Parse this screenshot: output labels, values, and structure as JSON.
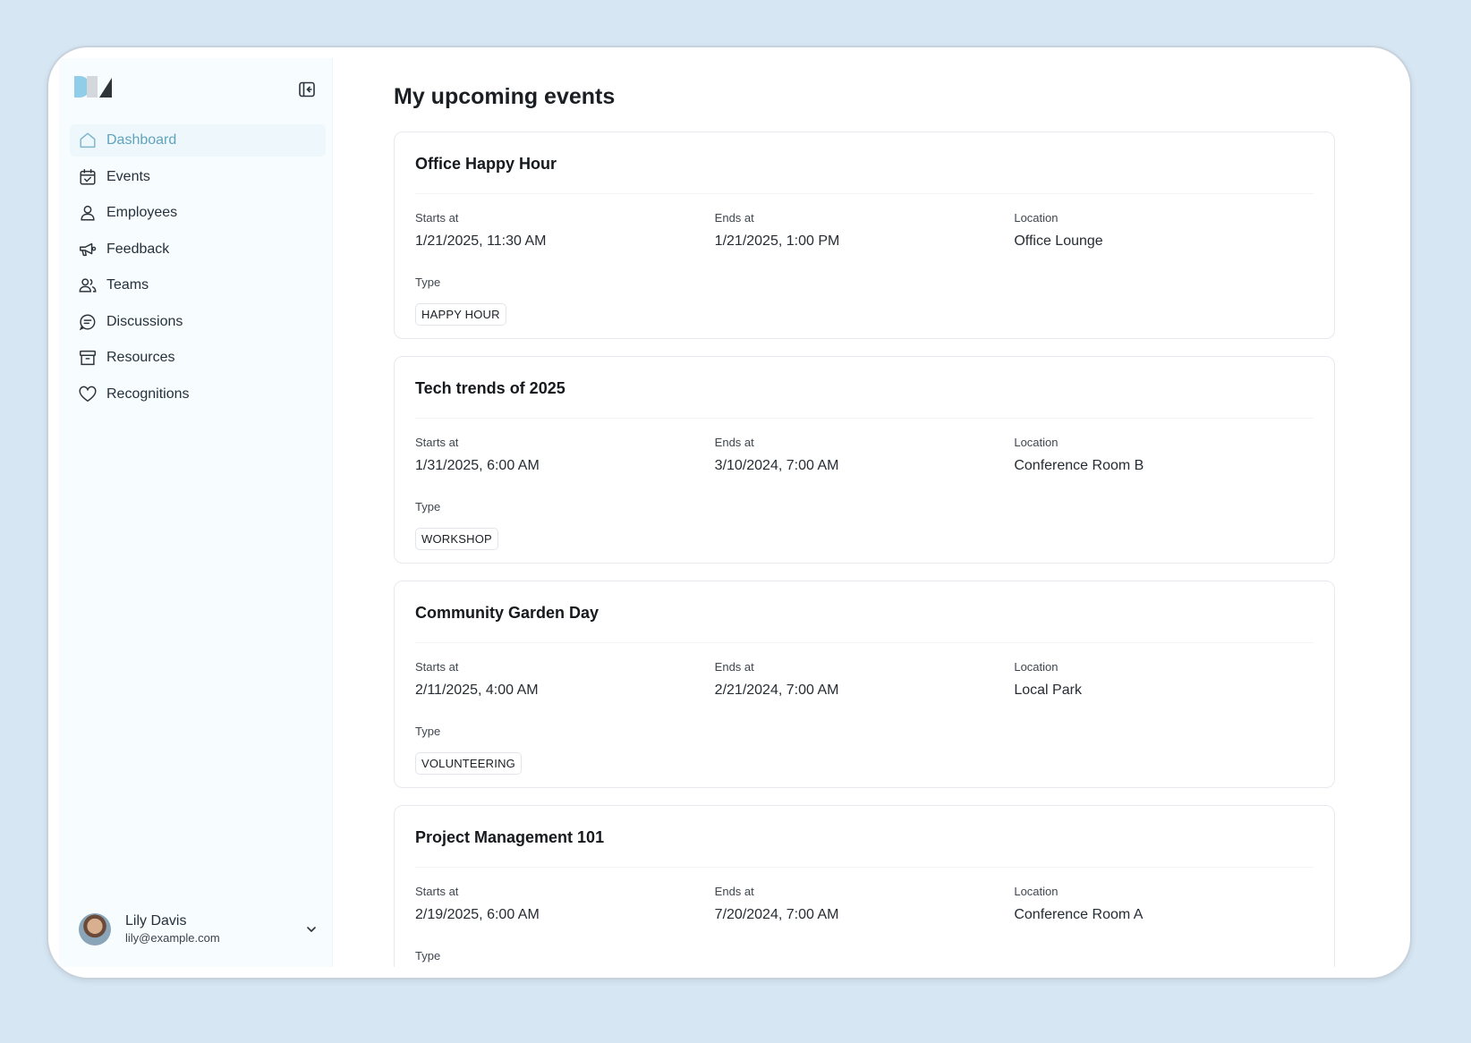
{
  "sidebar": {
    "logo": "brand-logo",
    "collapse_icon": "sidebar-collapse-icon",
    "items": [
      {
        "label": "Dashboard",
        "icon": "home-icon",
        "active": true
      },
      {
        "label": "Events",
        "icon": "calendar-check-icon",
        "active": false
      },
      {
        "label": "Employees",
        "icon": "user-icon",
        "active": false
      },
      {
        "label": "Feedback",
        "icon": "megaphone-icon",
        "active": false
      },
      {
        "label": "Teams",
        "icon": "users-icon",
        "active": false
      },
      {
        "label": "Discussions",
        "icon": "chat-bubble-icon",
        "active": false
      },
      {
        "label": "Resources",
        "icon": "archive-box-icon",
        "active": false
      },
      {
        "label": "Recognitions",
        "icon": "heart-icon",
        "active": false
      }
    ],
    "user": {
      "name": "Lily Davis",
      "email": "lily@example.com"
    }
  },
  "main": {
    "title": "My upcoming events",
    "field_labels": {
      "starts": "Starts at",
      "ends": "Ends at",
      "location": "Location",
      "type": "Type"
    },
    "events": [
      {
        "title": "Office Happy Hour",
        "starts": "1/21/2025, 11:30 AM",
        "ends": "1/21/2025, 1:00 PM",
        "location": "Office Lounge",
        "type": "HAPPY HOUR"
      },
      {
        "title": "Tech trends of 2025",
        "starts": "1/31/2025, 6:00 AM",
        "ends": "3/10/2024, 7:00 AM",
        "location": "Conference Room B",
        "type": "WORKSHOP"
      },
      {
        "title": "Community Garden Day",
        "starts": "2/11/2025, 4:00 AM",
        "ends": "2/21/2024, 7:00 AM",
        "location": "Local Park",
        "type": "VOLUNTEERING"
      },
      {
        "title": "Project Management 101",
        "starts": "2/19/2025, 6:00 AM",
        "ends": "7/20/2024, 7:00 AM",
        "location": "Conference Room A",
        "type": ""
      }
    ]
  },
  "colors": {
    "background": "#d7e6f3",
    "sidebar_bg": "#f7fcfe",
    "active_nav_text": "#5fa3bc",
    "active_nav_bg": "#eef7fb"
  }
}
